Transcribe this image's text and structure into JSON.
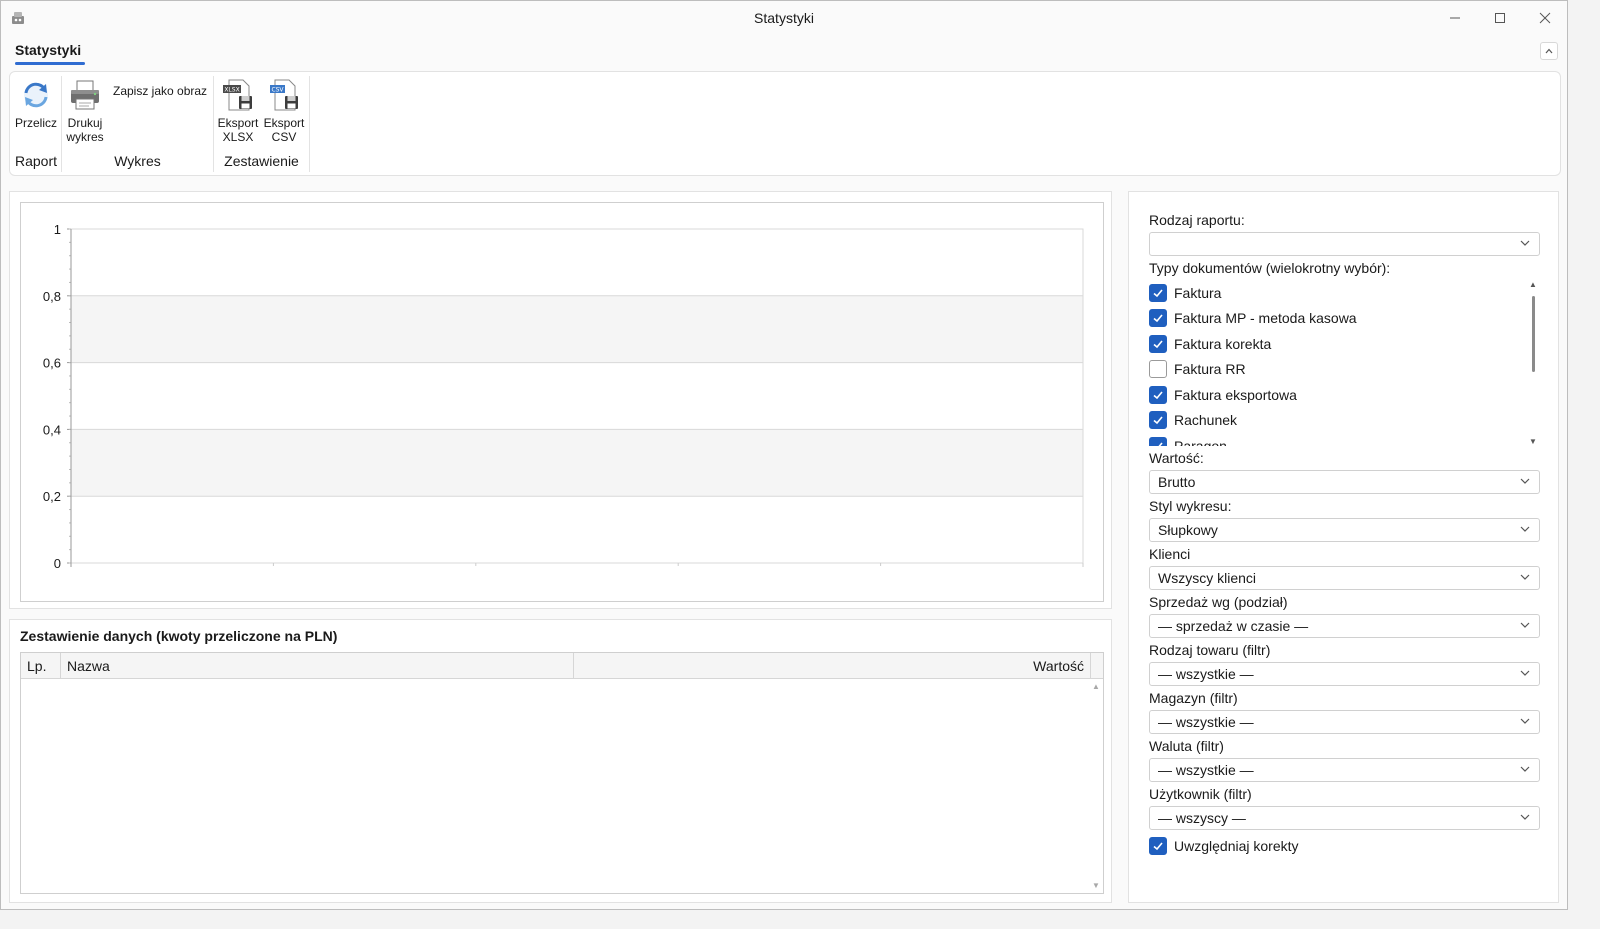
{
  "window": {
    "title": "Statystyki"
  },
  "ribbon_tab": {
    "label": "Statystyki"
  },
  "ribbon": {
    "groups": [
      {
        "title": "Raport",
        "buttons": [
          {
            "label": "Przelicz",
            "icon": "refresh-icon"
          }
        ]
      },
      {
        "title": "Wykres",
        "buttons": [
          {
            "label_line1": "Drukuj",
            "label_line2": "wykres",
            "icon": "printer-icon"
          },
          {
            "label": "Zapisz jako obraz"
          }
        ]
      },
      {
        "title": "Zestawienie",
        "buttons": [
          {
            "label_line1": "Eksport",
            "label_line2": "XLSX",
            "icon": "xlsx-export-icon"
          },
          {
            "label_line1": "Eksport",
            "label_line2": "CSV",
            "icon": "csv-export-icon"
          }
        ]
      }
    ]
  },
  "chart_data": {
    "type": "bar",
    "categories": [],
    "values": [],
    "y_ticks": [
      "1",
      "0,8",
      "0,6",
      "0,4",
      "0,2",
      "0"
    ],
    "ylim": [
      0,
      1
    ],
    "grid": true,
    "striped_bands": true
  },
  "table": {
    "title": "Zestawienie danych (kwoty przeliczone na PLN)",
    "columns": [
      "Lp.",
      "Nazwa",
      "Wartość"
    ],
    "rows": []
  },
  "side": {
    "report_type_label": "Rodzaj raportu:",
    "report_type_value": "",
    "doc_types_label": "Typy dokumentów (wielokrotny wybór):",
    "doc_types": [
      {
        "label": "Faktura",
        "checked": true
      },
      {
        "label": "Faktura MP - metoda kasowa",
        "checked": true
      },
      {
        "label": "Faktura korekta",
        "checked": true
      },
      {
        "label": "Faktura RR",
        "checked": false
      },
      {
        "label": "Faktura eksportowa",
        "checked": true
      },
      {
        "label": "Rachunek",
        "checked": true
      },
      {
        "label": "Paragon",
        "checked": true
      }
    ],
    "value_label": "Wartość:",
    "value_value": "Brutto",
    "chart_style_label": "Styl wykresu:",
    "chart_style_value": "Słupkowy",
    "clients_label": "Klienci",
    "clients_value": "Wszyscy klienci",
    "split_label": "Sprzedaż wg (podział)",
    "split_value": "— sprzedaż w czasie —",
    "product_type_label": "Rodzaj towaru (filtr)",
    "product_type_value": "— wszystkie —",
    "warehouse_label": "Magazyn (filtr)",
    "warehouse_value": "— wszystkie —",
    "currency_label": "Waluta (filtr)",
    "currency_value": "— wszystkie —",
    "user_label": "Użytkownik (filtr)",
    "user_value": "— wszyscy —",
    "include_corrections_label": "Uwzględniaj korekty",
    "include_corrections_checked": true
  },
  "colors": {
    "accent": "#1f5fbf",
    "tab_underline": "#2f6cd1",
    "chart_band": "#f5f5f5",
    "grid_line": "#d9d9d9"
  }
}
